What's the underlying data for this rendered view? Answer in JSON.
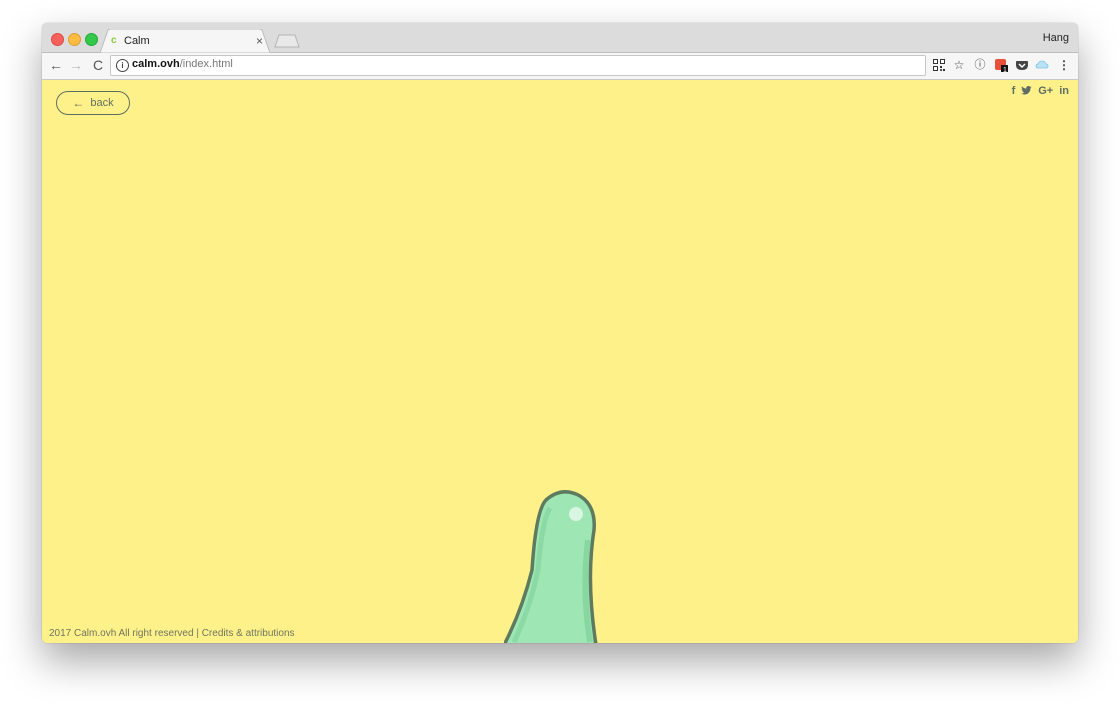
{
  "browser": {
    "tab_title": "Calm",
    "tab_favicon": "c",
    "tab_close": "×",
    "user_name": "Hang",
    "url_host": "calm.ovh",
    "url_path": "/index.html",
    "nav": {
      "back": "←",
      "forward": "→",
      "reload": "C"
    },
    "extensions": [
      "qr-code-icon",
      "star-icon",
      "info-icon",
      "badge-extension-icon",
      "pocket-icon",
      "cloud-icon",
      "menu-icon"
    ],
    "badge_count": "1"
  },
  "page": {
    "background": "#fff18a",
    "back_label": "back",
    "social": {
      "facebook": "f",
      "twitter": "🐦",
      "google_plus": "G+",
      "linkedin": "in"
    },
    "footer": {
      "text": "2017 Calm.ovh All right reserved",
      "separator": "|",
      "credits_link": "Credits & attributions"
    },
    "creature_colors": {
      "fill": "#9ee6b3",
      "outline": "#5e7a5f"
    }
  }
}
